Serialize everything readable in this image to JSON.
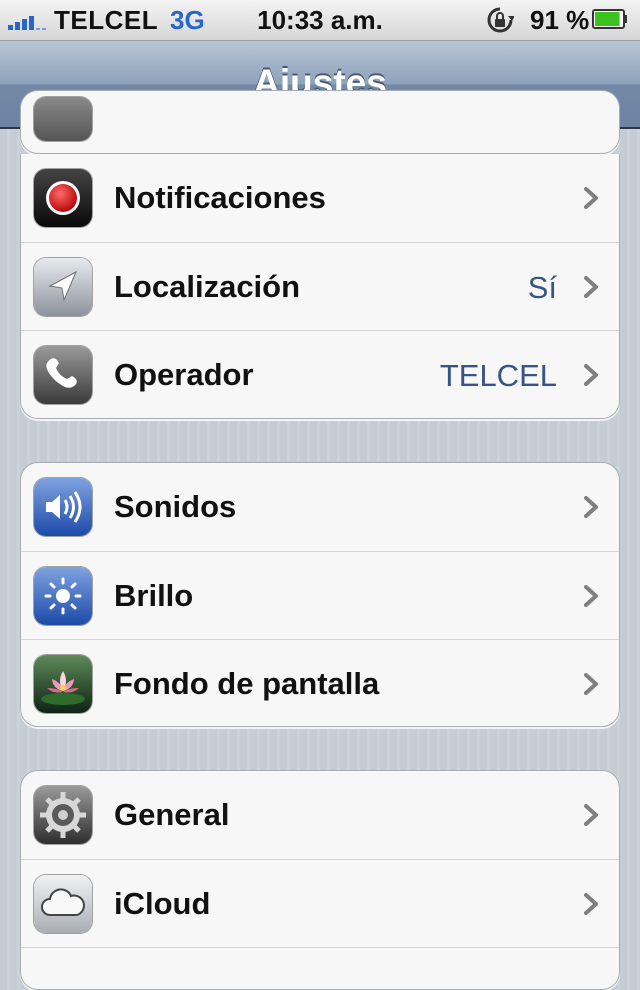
{
  "status_bar": {
    "carrier": "TELCEL",
    "network": "3G",
    "time": "10:33 a.m.",
    "battery_percent": "91 %",
    "signal_bars": 4,
    "battery_level": 0.91,
    "icons": [
      "signal-icon",
      "rotation-lock-icon",
      "battery-icon"
    ]
  },
  "nav": {
    "title": "Ajustes"
  },
  "groups": [
    {
      "rows": [
        {
          "label": "Notificaciones",
          "value": "",
          "icon": "notifications-icon"
        },
        {
          "label": "Localización",
          "value": "Sí",
          "icon": "location-icon"
        },
        {
          "label": "Operador",
          "value": "TELCEL",
          "icon": "phone-icon"
        }
      ]
    },
    {
      "rows": [
        {
          "label": "Sonidos",
          "value": "",
          "icon": "speaker-icon"
        },
        {
          "label": "Brillo",
          "value": "",
          "icon": "brightness-icon"
        },
        {
          "label": "Fondo de pantalla",
          "value": "",
          "icon": "wallpaper-icon"
        }
      ]
    },
    {
      "rows": [
        {
          "label": "General",
          "value": "",
          "icon": "gear-icon"
        },
        {
          "label": "iCloud",
          "value": "",
          "icon": "cloud-icon"
        }
      ]
    }
  ],
  "colors": {
    "value_text": "#385487",
    "signal": "#2a66c8",
    "battery": "#3cc21e"
  }
}
